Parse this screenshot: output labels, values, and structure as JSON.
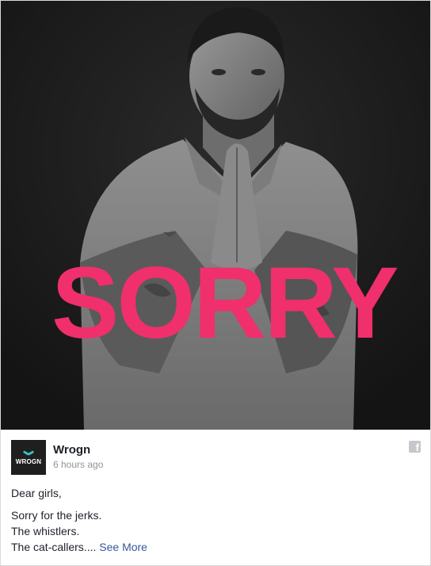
{
  "post": {
    "image_caption": "SORRY",
    "page_name": "Wrogn",
    "logo_text": "WROGN",
    "timestamp": "6 hours ago",
    "lines": [
      "Dear girls,",
      "Sorry for the jerks.",
      "The whistlers.",
      "The cat-callers...."
    ],
    "see_more": "See More"
  },
  "colors": {
    "accent": "#f02f6d",
    "link": "#365899",
    "logo_mark": "#36c3c3"
  },
  "icons": {
    "share": "facebook-icon"
  }
}
